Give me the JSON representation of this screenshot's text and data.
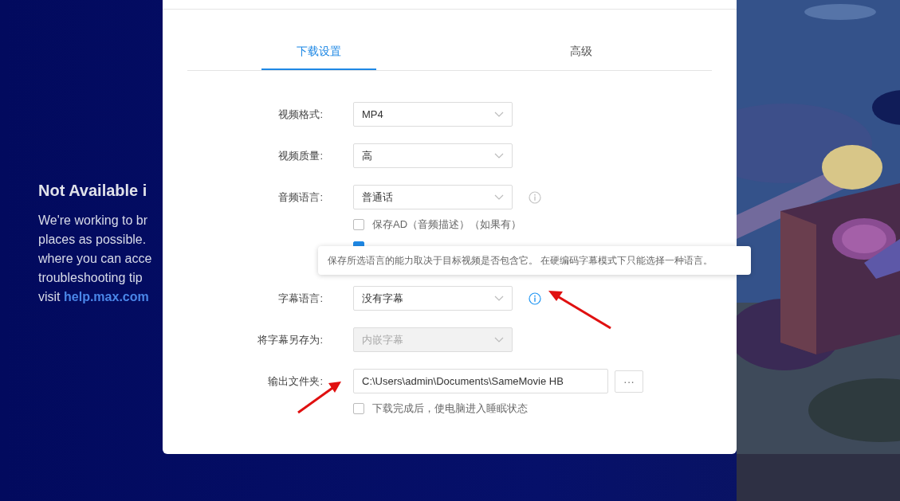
{
  "background_message": {
    "title": "Not Available i",
    "lines": [
      "We're working to br",
      "places as possible.",
      "where you can acce",
      "troubleshooting tip"
    ],
    "last_line": {
      "text": "visit",
      "link": "help.max.com"
    }
  },
  "tabs": [
    {
      "label": "下载设置",
      "selected": true
    },
    {
      "label": "高级",
      "selected": false
    }
  ],
  "fields": [
    {
      "kind": "select",
      "label": "视频格式:",
      "value": "MP4",
      "disabled": false
    },
    {
      "kind": "select",
      "label": "视频质量:",
      "value": "高",
      "disabled": false
    },
    {
      "kind": "select",
      "label": "音频语言:",
      "value": "普通话",
      "disabled": false,
      "info_active": false
    },
    {
      "kind": "checkbox",
      "label": "保存AD（音频描述）（如果有）",
      "checked": false
    },
    {
      "kind": "checkbox",
      "checked": true
    },
    {
      "kind": "select",
      "label": "字幕语言:",
      "value": "没有字幕",
      "disabled": false,
      "info_active": true
    },
    {
      "kind": "select",
      "label": "将字幕另存为:",
      "value": "内嵌字幕",
      "disabled": true
    },
    {
      "kind": "path",
      "label": "输出文件夹:",
      "value": "C:\\Users\\admin\\Documents\\SameMovie HB",
      "button": "···"
    },
    {
      "kind": "checkbox",
      "label": "下载完成后，使电脑进入睡眠状态",
      "checked": false
    }
  ],
  "tooltip": {
    "text": "保存所选语言的能力取决于目标视频是否包含它。 在硬编码字幕模式下只能选择一种语言。"
  }
}
